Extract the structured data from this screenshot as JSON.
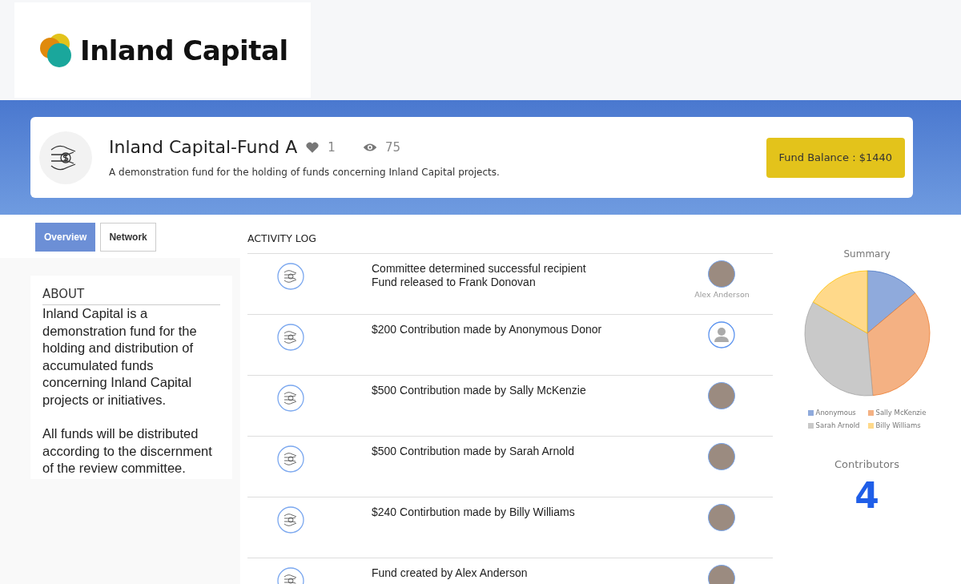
{
  "brand": {
    "name": "Inland Capital"
  },
  "fund": {
    "title": "Inland Capital-Fund A",
    "likes": "1",
    "views": "75",
    "description": "A demonstration fund for the holding of funds concerning Inland Capital projects.",
    "balance": "Fund Balance : $1440"
  },
  "tabs": [
    {
      "label": "Overview",
      "selected": true
    },
    {
      "label": "Network",
      "selected": false
    }
  ],
  "about": {
    "heading": "ABOUT",
    "paragraphs": [
      "Inland Capital is a demonstration fund for the holding and distribution of accumulated funds concerning Inland Capital projects or initiatives.",
      "All funds will be distributed according to the discernment of the review committee."
    ]
  },
  "activity_log": {
    "heading": "ACTIVITY LOG",
    "entries": [
      {
        "lines": [
          "Committee determined successful recipient",
          "Fund released to Frank Donovan"
        ],
        "kind": "photo",
        "caption": "Alex Anderson"
      },
      {
        "lines": [
          "$200 Contribution made by Anonymous Donor"
        ],
        "kind": "silhouette"
      },
      {
        "lines": [
          "$500 Contribution made by Sally McKenzie"
        ],
        "kind": "photo"
      },
      {
        "lines": [
          "$500 Contribution made by Sarah Arnold"
        ],
        "kind": "photo"
      },
      {
        "lines": [
          "$240 Contirbution made by Billy Williams"
        ],
        "kind": "photo"
      },
      {
        "lines": [
          "Fund created by Alex Anderson"
        ],
        "kind": "photo"
      }
    ]
  },
  "summary": {
    "chart_data": {
      "type": "pie",
      "title": "Summary",
      "categories": [
        "Anonymous",
        "Sally McKenzie",
        "Sarah Arnold",
        "Billy Williams"
      ],
      "values": [
        13.9,
        34.7,
        34.7,
        16.7
      ],
      "colors": [
        "#8faadc",
        "#f4b183",
        "#c9c9c9",
        "#ffd98a"
      ]
    }
  },
  "contributors": {
    "label": "Contributors",
    "count": "4"
  }
}
